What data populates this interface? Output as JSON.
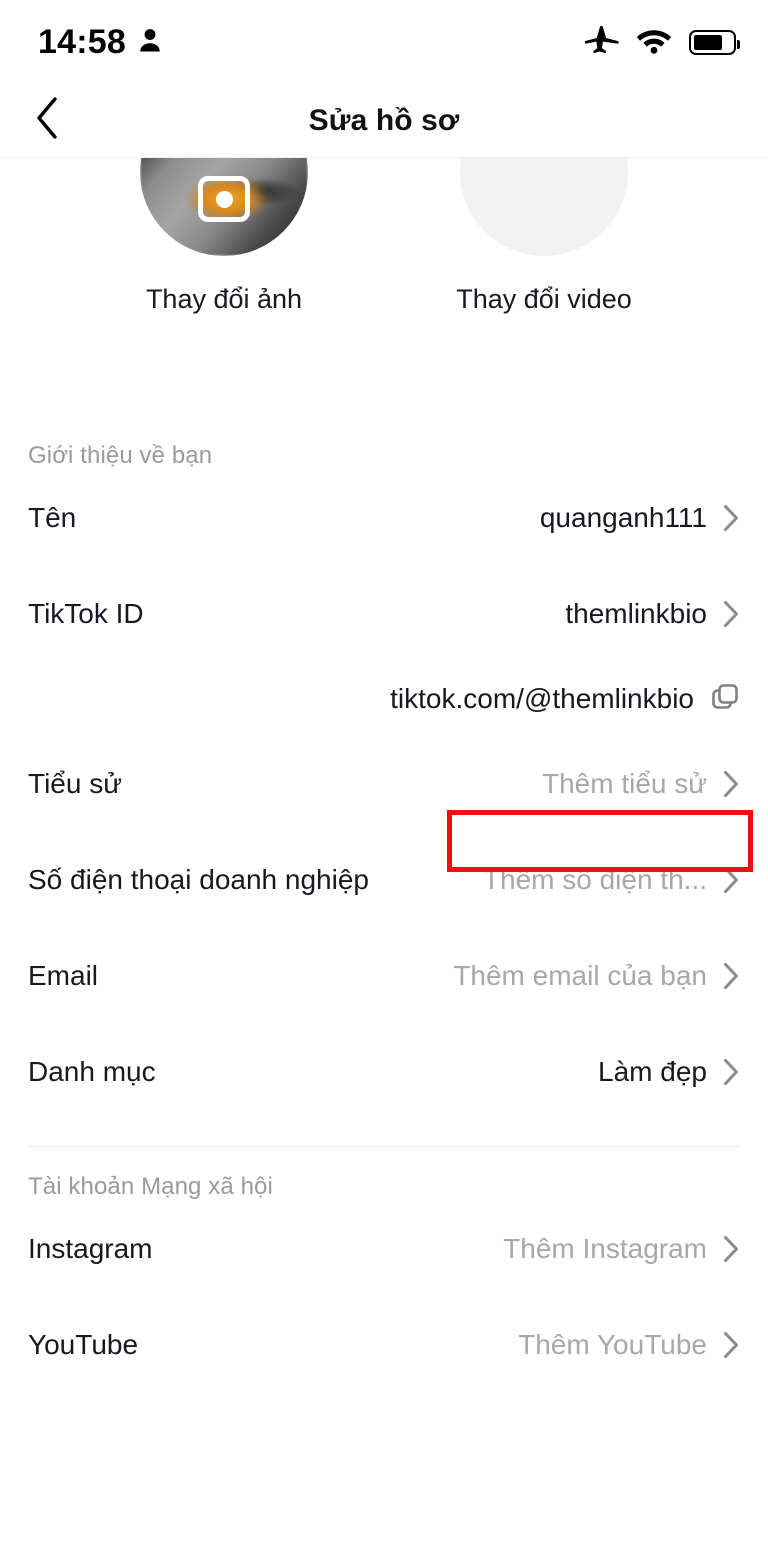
{
  "status_bar": {
    "time": "14:58",
    "person_icon": "person-icon",
    "airplane_icon": "airplane-mode-icon",
    "wifi_icon": "wifi-icon",
    "battery_icon": "battery-icon"
  },
  "header": {
    "title": "Sửa hồ sơ",
    "back_icon": "back-chevron-icon"
  },
  "media": {
    "photo": {
      "label": "Thay đổi ảnh",
      "icon": "camera-icon"
    },
    "video": {
      "label": "Thay đổi video",
      "icon": "video-camera-icon"
    }
  },
  "sections": [
    {
      "title": "Giới thiệu về bạn",
      "rows": [
        {
          "label": "Tên",
          "value": "quanganh111",
          "is_placeholder": false
        },
        {
          "label": "TikTok ID",
          "value": "themlinkbio",
          "is_placeholder": false
        }
      ],
      "profile_link": {
        "value": "tiktok.com/@themlinkbio",
        "icon": "copy-icon"
      },
      "rows_after": [
        {
          "label": "Tiểu sử",
          "value": "Thêm tiểu sử",
          "is_placeholder": true,
          "highlighted": true
        },
        {
          "label": "Số điện thoại doanh nghiệp",
          "value": "Thêm số điện th...",
          "is_placeholder": true
        },
        {
          "label": "Email",
          "value": "Thêm email của bạn",
          "is_placeholder": true
        },
        {
          "label": "Danh mục",
          "value": "Làm đẹp",
          "is_placeholder": false
        }
      ]
    },
    {
      "title": "Tài khoản Mạng xã hội",
      "rows": [
        {
          "label": "Instagram",
          "value": "Thêm Instagram",
          "is_placeholder": true
        },
        {
          "label": "YouTube",
          "value": "Thêm YouTube",
          "is_placeholder": true
        }
      ]
    }
  ],
  "colors": {
    "text_primary": "#161823",
    "text_secondary": "#a7a7ac",
    "section_title": "#9b9b9f",
    "highlight": "#ee1111",
    "divider": "#eeeeef",
    "video_bg": "#f1f1f2"
  }
}
